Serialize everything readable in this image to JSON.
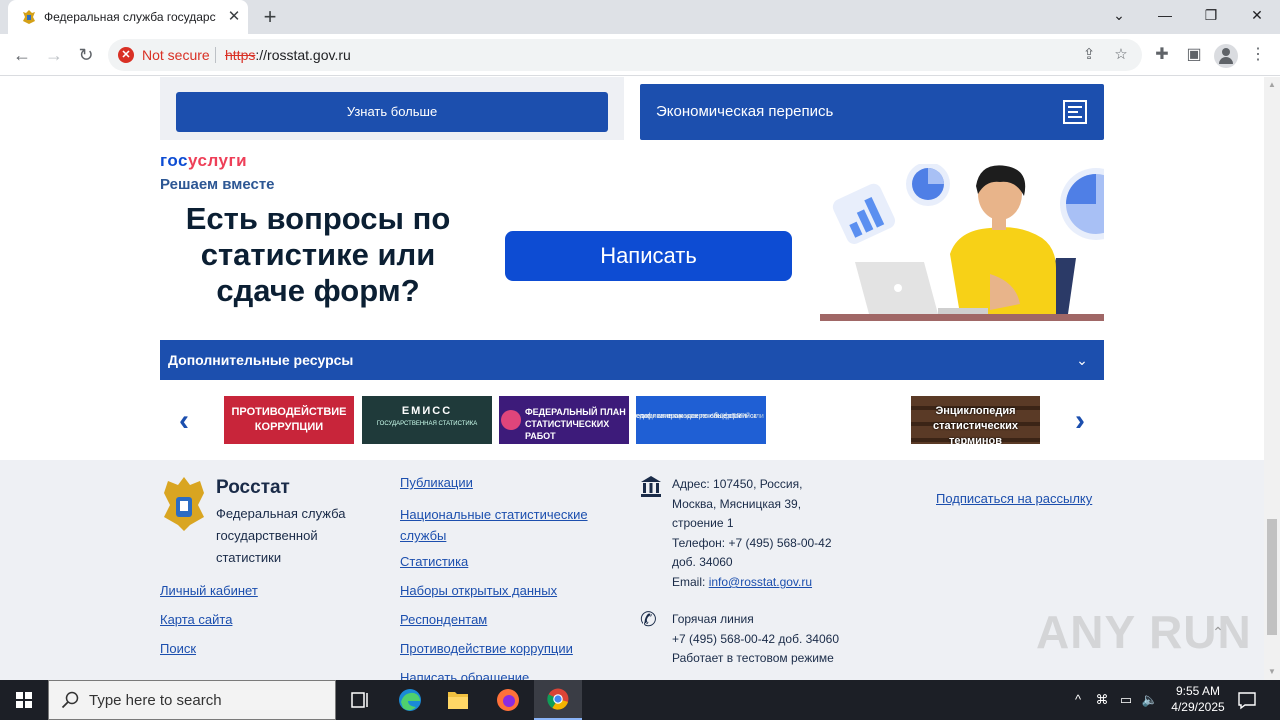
{
  "browser": {
    "tab_title": "Федеральная служба государственной статистики",
    "tab_close": "✕",
    "new_tab": "+",
    "security_label": "Not secure",
    "url_scheme": "https",
    "url_rest": "://rosstat.gov.ru",
    "icons": [
      "back-icon",
      "forward-icon",
      "reload-icon",
      "share-icon",
      "star-icon",
      "extensions-icon",
      "sidepanel-icon",
      "profile-icon",
      "menu-icon"
    ]
  },
  "page": {
    "learn_more": "Узнать больше",
    "census": "Экономическая перепись",
    "gosuslugi_part1": "гос",
    "gosuslugi_part2": "услуги",
    "gos_tagline": "Решаем вместе",
    "question": "Есть вопросы по статистике или сдаче форм?",
    "write_button": "Написать",
    "resources_title": "Дополнительные ресурсы",
    "banners": {
      "b1": "ПРОТИВОДЕЙСТВИЕ КОРРУПЦИИ",
      "b2_title": "ЕМИСС",
      "b2_sub": "ГОСУДАРСТВЕННАЯ СТАТИСТИКА",
      "b3": "ФЕДЕРАЛЬНЫЙ ПЛАН СТАТИСТИЧЕСКИХ РАБОТ",
      "b4_line1": "едомление о кодах по общероссийск",
      "b4_line2": "ссификаторам и перечень форм",
      "b4_line3": "ть один из параметров ИНН, ОГРН или О",
      "b5": "Энциклопедия статистических терминов"
    }
  },
  "footer": {
    "brand": "Росстат",
    "brand_sub": "Федеральная служба государственной статистики",
    "col1": [
      "Личный кабинет",
      "Карта сайта",
      "Поиск"
    ],
    "col2": [
      "Публикации",
      "Национальные статистические службы",
      "Статистика",
      "Наборы открытых данных",
      "Респондентам",
      "Противодействие коррупции",
      "Написать обращение"
    ],
    "address_line1": "Адрес: 107450, Россия,",
    "address_line2": "Москва, Мясницкая 39,",
    "address_line3": "строение 1",
    "phone_line1": "Телефон: +7 (495) 568-00-42",
    "phone_line2": "доб. 34060",
    "email_label": "Email: ",
    "email": "info@rosstat.gov.ru",
    "hotline_title": "Горячая линия",
    "hotline_phone": "+7 (495) 568-00-42 доб. 34060",
    "hotline_note": "Работает в тестовом режиме",
    "subscribe": "Подписаться на рассылку"
  },
  "watermark": "ANY RUN",
  "taskbar": {
    "search_placeholder": "Type here to search",
    "time": "9:55 AM",
    "date": "4/29/2025"
  }
}
